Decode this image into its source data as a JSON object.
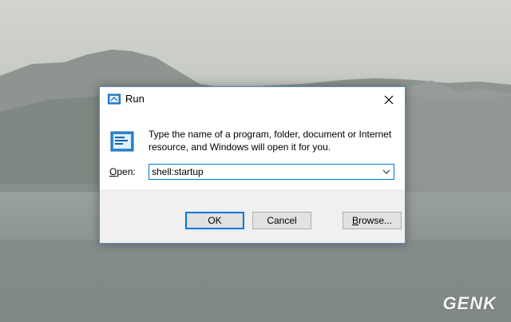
{
  "dialog": {
    "title": "Run",
    "description": "Type the name of a program, folder, document or Internet resource, and Windows will open it for you.",
    "open_label_accel": "O",
    "open_label_rest": "pen:",
    "open_value": "shell:startup"
  },
  "buttons": {
    "ok": "OK",
    "cancel": "Cancel",
    "browse_accel": "B",
    "browse_rest": "rowse..."
  },
  "watermark": "GENK",
  "colors": {
    "accent": "#0078d7",
    "dialog_border": "#5b8ec3",
    "button_face": "#e1e1e1"
  },
  "icons": {
    "title": "run-app-icon",
    "body": "run-app-icon",
    "close": "close-icon",
    "dropdown": "chevron-down-icon"
  }
}
